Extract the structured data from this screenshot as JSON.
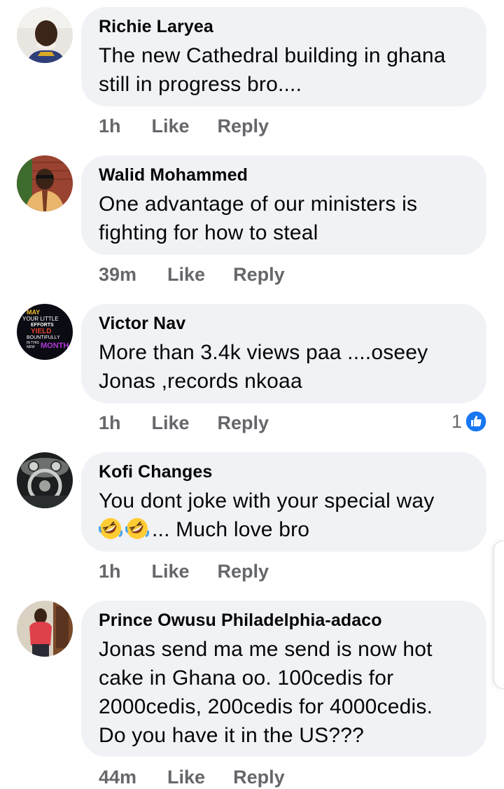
{
  "comments": [
    {
      "author": "Richie Laryea",
      "text": "The new Cathedral building in ghana\nstill in progress bro....",
      "time": "1h",
      "like_label": "Like",
      "reply_label": "Reply"
    },
    {
      "author": "Walid Mohammed",
      "text": "One advantage of our ministers is\nfighting for how to steal",
      "time": "39m",
      "like_label": "Like",
      "reply_label": "Reply"
    },
    {
      "author": "Victor Nav",
      "text": "More than 3.4k views paa ....oseey\nJonas ,records nkoaa",
      "time": "1h",
      "like_label": "Like",
      "reply_label": "Reply",
      "reaction_count": "1",
      "avatar_text": [
        "MAY",
        "YOUR LITTLE",
        "EFFORTS",
        "YIELD",
        "BOUNTIFULLY",
        "IN THIS",
        "NEW",
        "MONTH"
      ]
    },
    {
      "author": "Kofi Changes",
      "text_before_emoji": "",
      "text_after_emoji": "... Much love bro",
      "text_line1": "You dont joke with your special way",
      "emoji": "rolling-on-floor-laughing",
      "time": "1h",
      "like_label": "Like",
      "reply_label": "Reply"
    },
    {
      "author": "Prince Owusu Philadelphia-adaco",
      "text": "Jonas send ma me send is now hot\ncake in Ghana oo. 100cedis for\n2000cedis, 200cedis for 4000cedis.\nDo you have it in the US???",
      "time": "44m",
      "like_label": "Like",
      "reply_label": "Reply"
    }
  ],
  "colors": {
    "bubble": "#f0f2f5",
    "meta_text": "#65676b",
    "like_blue": "#1877f2"
  }
}
